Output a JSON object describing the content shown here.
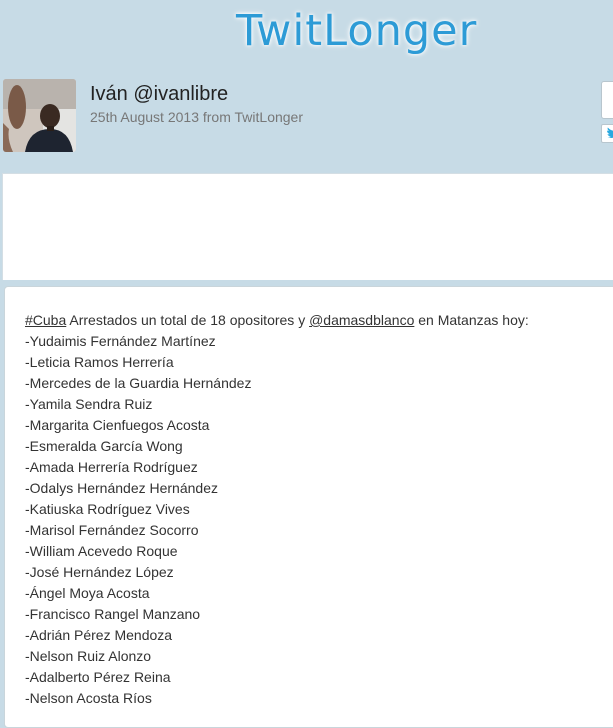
{
  "site": {
    "logo_text": "TwitLonger"
  },
  "author": {
    "name_handle": "Iván @ivanlibre",
    "meta": "25th August 2013 from TwitLonger"
  },
  "post": {
    "intro": {
      "hashtag": "#Cuba",
      "text_1": " Arrestados un total de 18 opositores y ",
      "mention": "@damasdblanco",
      "text_2": " en Matanzas hoy:"
    },
    "names": [
      "-Yudaimis Fernández Martínez",
      "-Leticia Ramos Herrería",
      "-Mercedes de la Guardia Hernández",
      "-Yamila Sendra Ruiz",
      "-Margarita Cienfuegos Acosta",
      "-Esmeralda García Wong",
      "-Amada Herrería Rodríguez",
      "-Odalys Hernández Hernández",
      "-Katiuska Rodríguez Vives",
      "-Marisol Fernández Socorro",
      "-William Acevedo Roque",
      "-José Hernández López",
      "-Ángel Moya Acosta",
      "-Francisco Rangel Manzano",
      "-Adrián Pérez Mendoza",
      "-Nelson Ruiz Alonzo",
      "-Adalberto Pérez Reina",
      "-Nelson Acosta Ríos"
    ]
  },
  "icons": {
    "side_button": "twitter-bird-icon"
  },
  "colors": {
    "background": "#c7dbe6",
    "logo": "#2d9bd6",
    "text": "#333333",
    "meta": "#777777",
    "twitter_blue": "#2aa9e0"
  }
}
